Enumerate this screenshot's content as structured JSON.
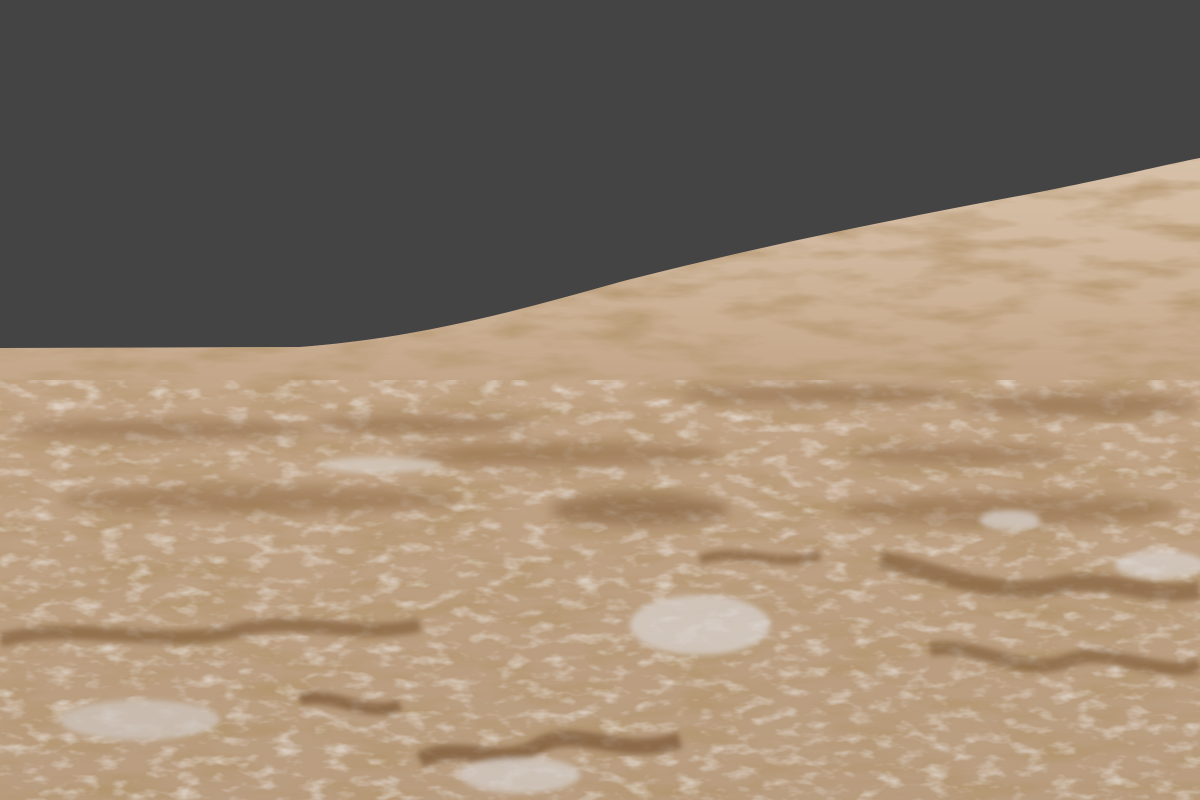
{
  "scene": {
    "sky_color": "#444444",
    "terrain_colors": {
      "far": "#c9ae92",
      "mid": "#bfa385",
      "near": "#b89a7b",
      "shadow": "#8a6642",
      "dark_streak": "#7a5632",
      "highlight": "#d8cfc8",
      "pale_rock": "#c7c3c3"
    }
  }
}
